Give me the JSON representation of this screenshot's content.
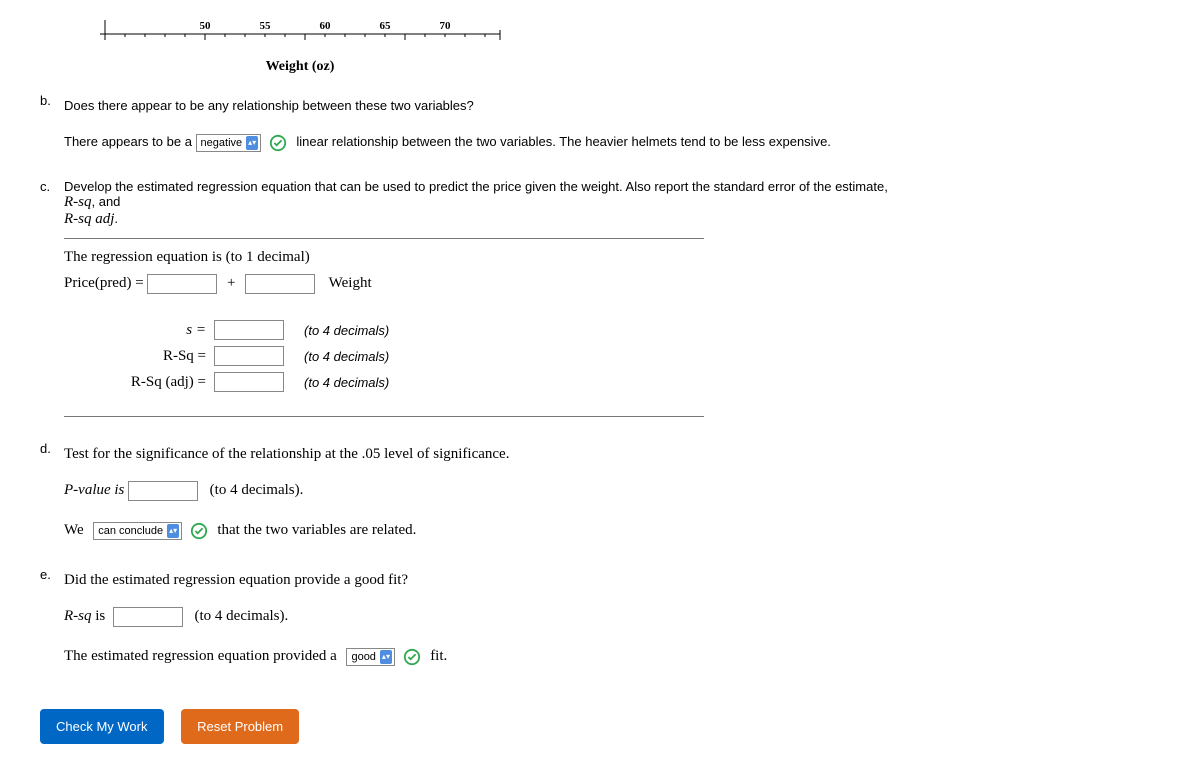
{
  "axis": {
    "ticks": [
      "50",
      "55",
      "60",
      "65",
      "70"
    ],
    "label": "Weight (oz)"
  },
  "b": {
    "letter": "b.",
    "question": "Does there appear to be any relationship between these two variables?",
    "pre": "There appears to be a",
    "select": "negative",
    "post": "linear relationship between the two variables. The heavier helmets tend to be less expensive."
  },
  "c": {
    "letter": "c.",
    "question_line1": "Develop the estimated regression equation that can be used to predict the price given the weight. Also report the standard error of the estimate,",
    "question_line2": "R-sq",
    "question_line2_rest": ", and",
    "question_line3": "R-sq adj",
    "question_line3_rest": ".",
    "eq_intro": "The regression equation is (to 1 decimal)",
    "eq_left": "Price(pred) =",
    "eq_plus": "+",
    "eq_right": "Weight",
    "stats": [
      {
        "label": "s =",
        "hint": "(to 4 decimals)"
      },
      {
        "label": "R-Sq =",
        "hint": "(to 4 decimals)"
      },
      {
        "label": "R-Sq (adj) =",
        "hint": "(to 4 decimals)"
      }
    ]
  },
  "d": {
    "letter": "d.",
    "question": "Test for the significance of the relationship at the .05 level of significance.",
    "pval_label": "P-value is",
    "pval_hint": "(to 4 decimals).",
    "we": "We",
    "select": "can conclude",
    "post": "that the two variables are related."
  },
  "e": {
    "letter": "e.",
    "question": "Did the estimated regression equation provide a good fit?",
    "rsq_label": "R-sq",
    "rsq_rest": " is",
    "rsq_hint": "(to 4 decimals).",
    "concl_pre": "The estimated regression equation provided a",
    "select": "good",
    "concl_post": "fit."
  },
  "buttons": {
    "check": "Check My Work",
    "reset": "Reset Problem"
  }
}
